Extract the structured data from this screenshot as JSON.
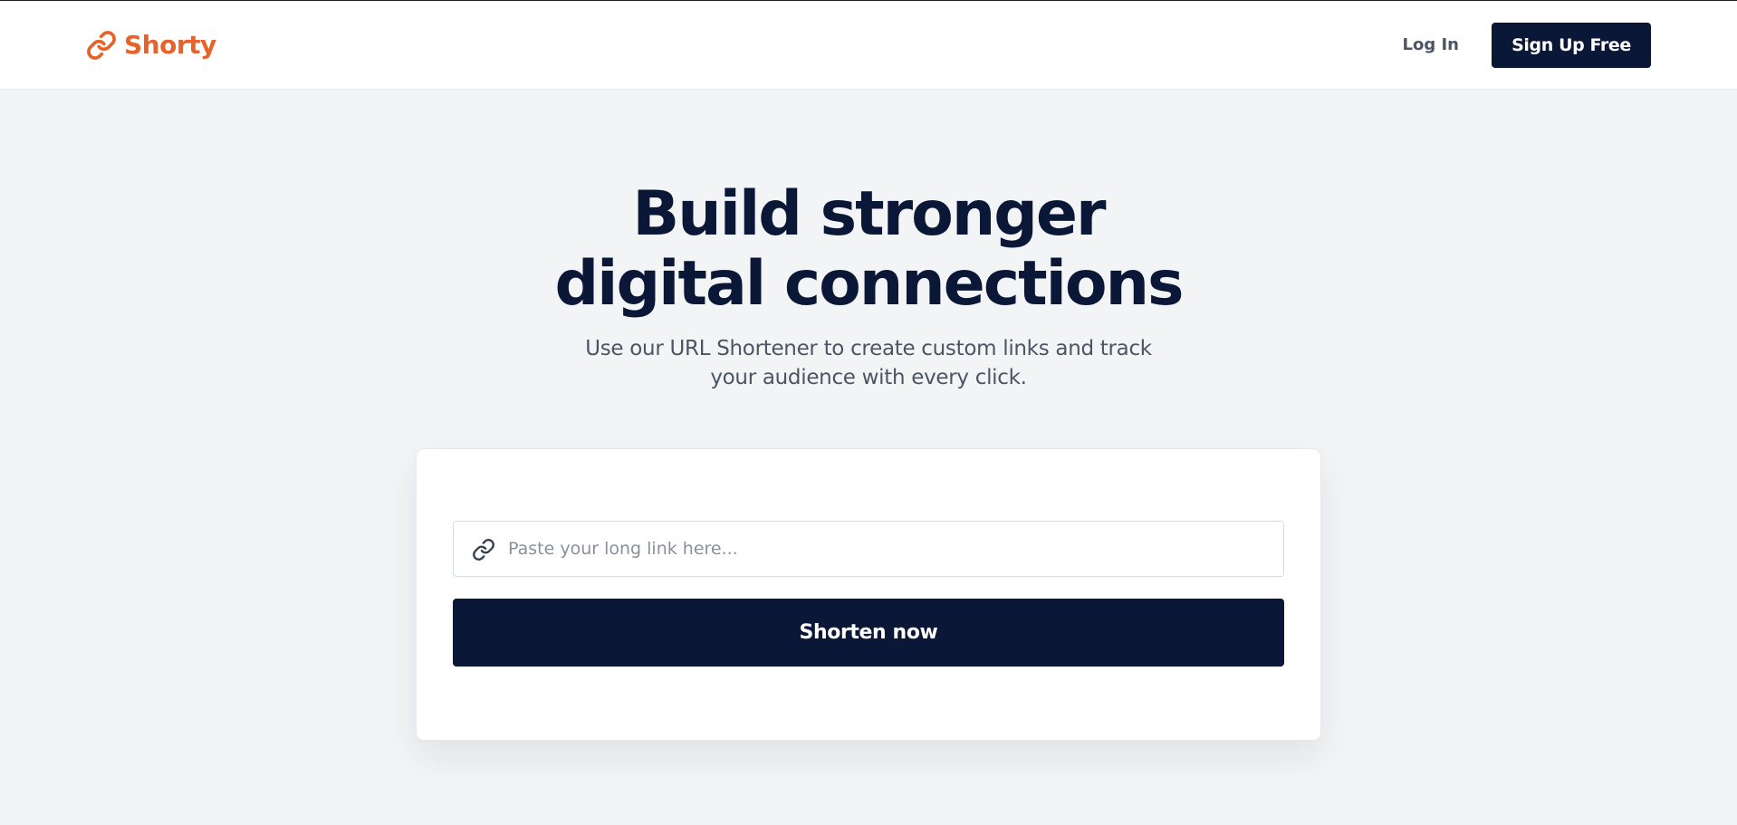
{
  "colors": {
    "brand": "#e8632b",
    "navy": "#0b1736",
    "page_bg": "#f3f4f6",
    "muted_text": "#4b5563"
  },
  "header": {
    "brand_icon": "link-icon",
    "brand_name": "Shorty",
    "login_label": "Log In",
    "signup_label": "Sign Up Free"
  },
  "hero": {
    "title": "Build stronger digital connections",
    "subtitle": "Use our URL Shortener to create custom links and track your audience with every click."
  },
  "shortener": {
    "input_icon": "link-icon",
    "input_value": "",
    "input_placeholder": "Paste your long link here...",
    "submit_label": "Shorten now"
  }
}
